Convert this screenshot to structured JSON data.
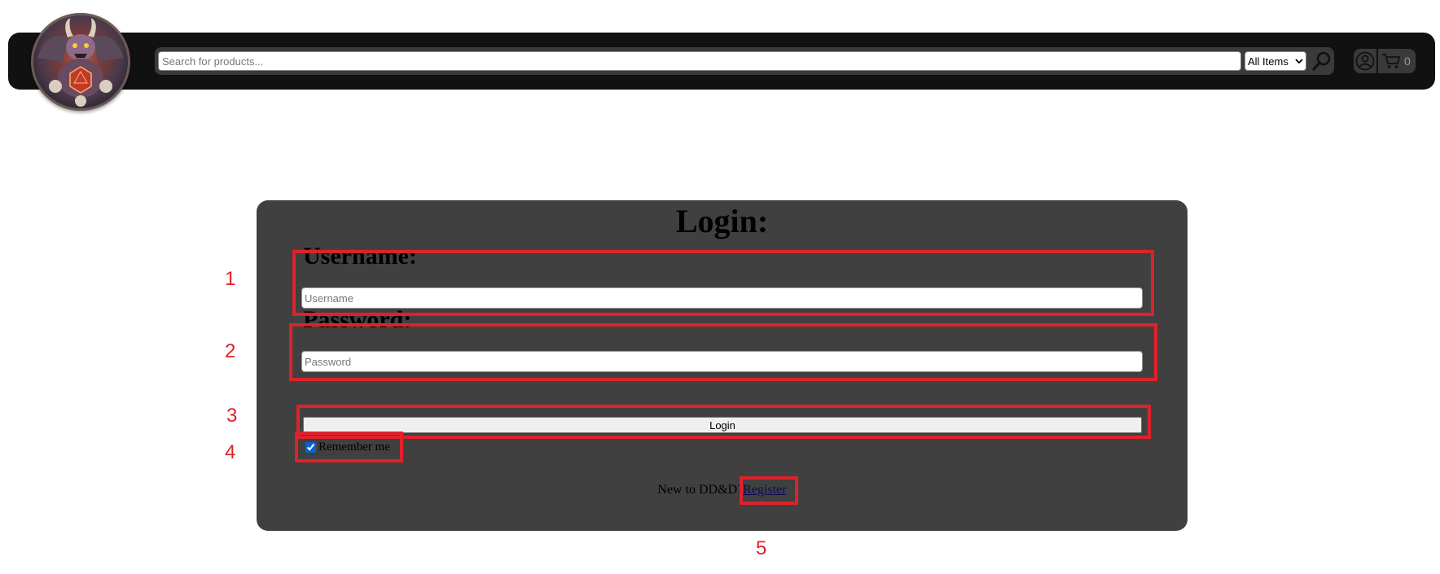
{
  "header": {
    "logo_alt": "DD&D logo",
    "search": {
      "placeholder": "Search for products...",
      "value": ""
    },
    "category_select": {
      "selected": "All Items"
    },
    "icons": {
      "search": "magnifier-icon",
      "account": "user-circle-icon",
      "cart": "shopping-cart-icon"
    },
    "cart_count": "0"
  },
  "login": {
    "title": "Login:",
    "username_label": "Username:",
    "username_placeholder": "Username",
    "password_label": "Password:",
    "password_placeholder": "Password",
    "submit_label": "Login",
    "remember_label": "Remember me",
    "remember_checked": true,
    "register_prompt": "New to DD&D?",
    "register_link": "Register"
  },
  "annotations": {
    "numbers": [
      "1",
      "2",
      "3",
      "4",
      "5"
    ],
    "color": "#e0212a"
  },
  "colors": {
    "header_bg": "#111111",
    "card_bg": "#404040",
    "annotation": "#e0212a"
  }
}
